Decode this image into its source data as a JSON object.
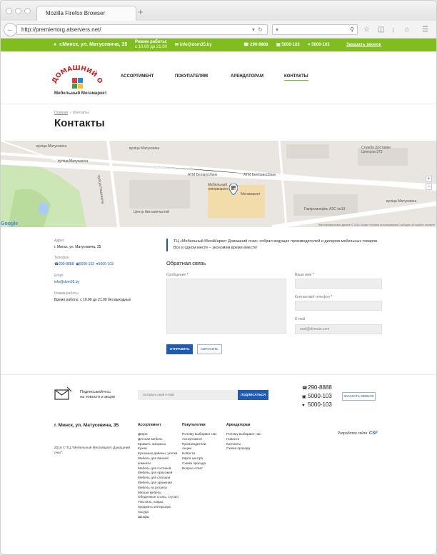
{
  "browser": {
    "window_title": "Mozilla Firefox Browser",
    "url": "http://premiertorg.atservers.net/"
  },
  "topbar": {
    "address": "г.Минск, ул. Матусевича, 35",
    "hours_label": "Режим работы:",
    "hours": "с 10.00 до 21.00",
    "email": "info@dom35.by",
    "phones": [
      "290-8888",
      "5000-103",
      "5000-103"
    ],
    "callback": "Заказать звонок",
    "accent": "#7fbe1e"
  },
  "header": {
    "logo_text": "Домашний очаг",
    "logo_sub": "Мебельный Мегамаркет",
    "menu": [
      "АССОРТИМЕНТ",
      "ПОКУПАТЕЛЯМ",
      "АРЕНДАТОРАМ",
      "КОНТАКТЫ"
    ],
    "active": "КОНТАКТЫ"
  },
  "breadcrumb": {
    "home": "Главная",
    "current": "Контакты"
  },
  "page_title": "Контакты",
  "map": {
    "streets": [
      "вуліца Матусевіча",
      "вуліца Матусевіча",
      "вуліца Матусевіча",
      "вуліца Пашкевіча",
      "вуліца Матусевіча"
    ],
    "places": {
      "service": "Служба Доставки Центров 373",
      "atm1": "ATM Беларусбанк",
      "atm2": "ATM БелСвиссБанк",
      "mall": "Мебельный гипермаркет...",
      "mega": "Мегамаркет",
      "center": "Центр Автозапчастей",
      "gas": "Газпромнефть АЗС №19"
    },
    "google": "Google",
    "copyright": "Картографические данные © 2016 Google   Условия использования   Сообщить об ошибке на карте",
    "zoom_in": "+",
    "zoom_out": "−"
  },
  "contacts": {
    "address_label": "Адрес",
    "address": "г. Минск, ул. Матусевича, 35",
    "phone_label": "Телефон",
    "phones": [
      "290-8888",
      "5000-103",
      "5000-103"
    ],
    "email_label": "Email",
    "email": "info@dom35.by",
    "hours_label": "Режим работы",
    "hours": "Время работы: с 10.00 до 21.00 без выходных"
  },
  "intro": {
    "line1": "ТЦ «Мебельный МегаМаркет Домашний очаг» собрал ведущих производителей и дилеров мебельных товаров.",
    "line2": "Все в одном месте – экономим время вместе!"
  },
  "feedback": {
    "title": "Обратная связь",
    "message_label": "Сообщение",
    "name_label": "Ваше имя",
    "phone_label": "Контактный телефон",
    "email_label": "E-mail",
    "email_placeholder": "mail@domain.com",
    "submit": "ОТПРАВИТЬ",
    "reset": "СБРОСИТЬ"
  },
  "subscribe": {
    "text1": "Подписывайтесь",
    "text2": "на новости и акции",
    "placeholder": "Оставьте свой e-mail",
    "button": "ПОДПИСАТЬСЯ"
  },
  "footer_phones": [
    "290-8888",
    "5000-103",
    "5000-103"
  ],
  "footer_callback": "ЗАКАЗАТЬ ЗВОНОК",
  "footer": {
    "address": "г. Минск, ул. Матусевича, 35",
    "copyright": "2016 © ТЦ \"Мебельный МегаМаркет Домашний очаг\".",
    "col1_title": "Ассортимент",
    "col1": [
      "Двери",
      "Детская мебель",
      "Кровати, матрасы",
      "Кухни",
      "Кухонные диваны, уголки",
      "Мебель для ванной комнаты",
      "Мебель для гостиной",
      "Мебель для прихожей",
      "Мебель для спальни",
      "Мебель для хранения",
      "Мебель из ротанга",
      "Мягкая мебель",
      "Обеденные столы, стулья",
      "Текстиль, ковры, предметы интерьера, посуда",
      "Шкафы"
    ],
    "col2_title": "Покупателям",
    "col2": [
      "Почему выбирают нас",
      "Ассортимент",
      "Производители",
      "Акции",
      "Новости",
      "Карта центра",
      "Схема проезда",
      "Вопрос-ответ"
    ],
    "col3_title": "Арендаторам",
    "col3": [
      "Почему выбирают нас",
      "Новости",
      "Контакты",
      "Схема проезда"
    ],
    "dev_label": "Разработка сайта",
    "dev_name": "CSF"
  }
}
